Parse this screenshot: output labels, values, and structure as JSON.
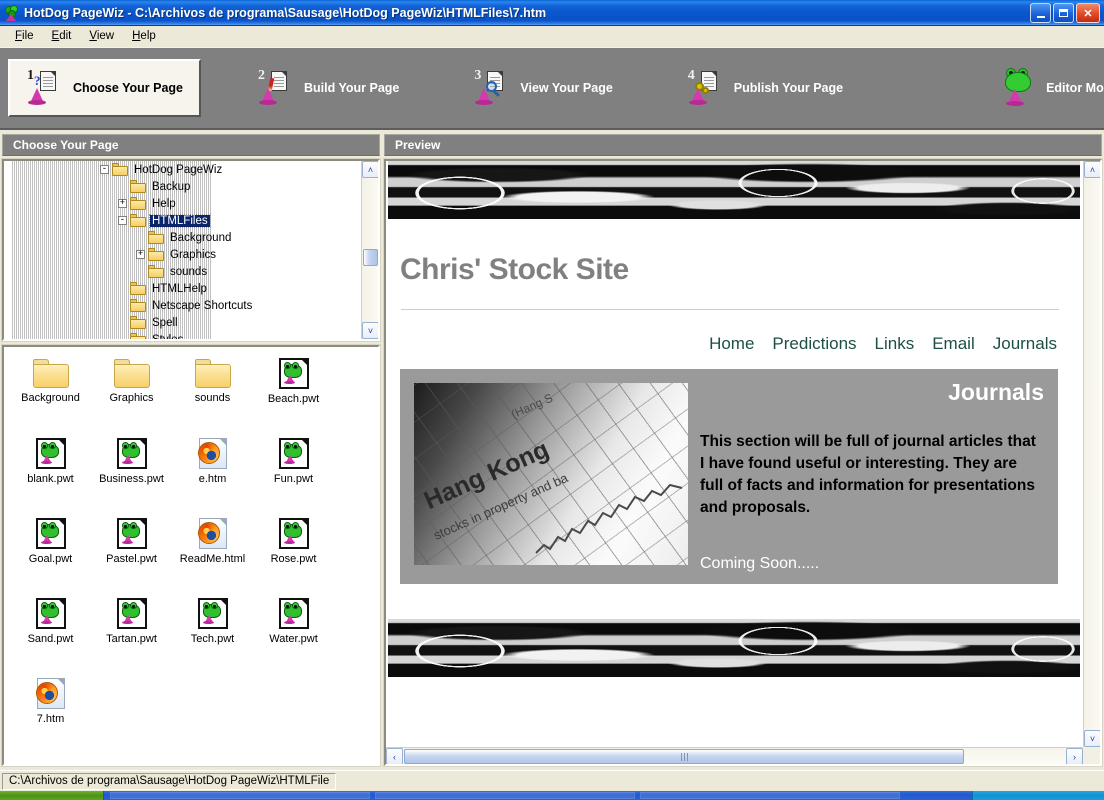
{
  "window": {
    "title": "HotDog PageWiz - C:\\Archivos de programa\\Sausage\\HotDog PageWiz\\HTMLFiles\\7.htm",
    "icon": "hotdog-pagewiz-frog-icon",
    "controls": {
      "minimize": "minimize-button",
      "maximize": "maximize-button",
      "close_label": "✕"
    }
  },
  "menubar": {
    "items": [
      {
        "label": "File",
        "accel": "F"
      },
      {
        "label": "Edit",
        "accel": "E"
      },
      {
        "label": "View",
        "accel": "V"
      },
      {
        "label": "Help",
        "accel": "H"
      }
    ]
  },
  "toolbar": {
    "steps": [
      {
        "number": "1",
        "label": "Choose Your Page",
        "icon": "page-question-wizard-icon",
        "active": true
      },
      {
        "number": "2",
        "label": "Build Your Page",
        "icon": "page-pen-wizard-icon",
        "active": false
      },
      {
        "number": "3",
        "label": "View Your Page",
        "icon": "page-magnifier-wizard-icon",
        "active": false
      },
      {
        "number": "4",
        "label": "Publish Your Page",
        "icon": "page-gears-wizard-icon",
        "active": false
      }
    ],
    "editor_mode": {
      "label": "Editor Mode",
      "icon": "frog-wizard-icon"
    }
  },
  "left_panel": {
    "header": "Choose Your Page",
    "tree": [
      {
        "label": "HotDog PageWiz",
        "depth": 0,
        "toggle": "-",
        "icon": "folder-icon",
        "selected": false
      },
      {
        "label": "Backup",
        "depth": 1,
        "toggle": "",
        "icon": "folder-icon",
        "selected": false
      },
      {
        "label": "Help",
        "depth": 1,
        "toggle": "+",
        "icon": "folder-icon",
        "selected": false
      },
      {
        "label": "HTMLFiles",
        "depth": 1,
        "toggle": "-",
        "icon": "folder-icon",
        "selected": true
      },
      {
        "label": "Background",
        "depth": 2,
        "toggle": "",
        "icon": "folder-icon",
        "selected": false
      },
      {
        "label": "Graphics",
        "depth": 2,
        "toggle": "+",
        "icon": "folder-icon",
        "selected": false
      },
      {
        "label": "sounds",
        "depth": 2,
        "toggle": "",
        "icon": "folder-icon",
        "selected": false
      },
      {
        "label": "HTMLHelp",
        "depth": 1,
        "toggle": "",
        "icon": "folder-icon",
        "selected": false
      },
      {
        "label": "Netscape Shortcuts",
        "depth": 1,
        "toggle": "",
        "icon": "folder-icon",
        "selected": false
      },
      {
        "label": "Spell",
        "depth": 1,
        "toggle": "",
        "icon": "folder-icon",
        "selected": false
      },
      {
        "label": "Styles",
        "depth": 1,
        "toggle": "",
        "icon": "folder-icon",
        "selected": false
      }
    ],
    "files": [
      {
        "name": "Background",
        "type": "folder"
      },
      {
        "name": "Graphics",
        "type": "folder"
      },
      {
        "name": "sounds",
        "type": "folder"
      },
      {
        "name": "Beach.pwt",
        "type": "pwt"
      },
      {
        "name": "blank.pwt",
        "type": "pwt"
      },
      {
        "name": "Business.pwt",
        "type": "pwt"
      },
      {
        "name": "e.htm",
        "type": "htm"
      },
      {
        "name": "Fun.pwt",
        "type": "pwt"
      },
      {
        "name": "Goal.pwt",
        "type": "pwt"
      },
      {
        "name": "Pastel.pwt",
        "type": "pwt"
      },
      {
        "name": "ReadMe.html",
        "type": "htm"
      },
      {
        "name": "Rose.pwt",
        "type": "pwt"
      },
      {
        "name": "Sand.pwt",
        "type": "pwt"
      },
      {
        "name": "Tartan.pwt",
        "type": "pwt"
      },
      {
        "name": "Tech.pwt",
        "type": "pwt"
      },
      {
        "name": "Water.pwt",
        "type": "pwt"
      },
      {
        "name": "7.htm",
        "type": "htm"
      }
    ]
  },
  "preview": {
    "header": "Preview",
    "page": {
      "banner_alt": "grayscale-liquid-banner-image",
      "site_title": "Chris' Stock Site",
      "nav": [
        "Home",
        "Predictions",
        "Links",
        "Email",
        "Journals"
      ],
      "section": {
        "heading": "Journals",
        "photo_alt": "hong-kong-stocks-newspaper-photo",
        "photo_text_main": "Hang Kong",
        "photo_text_sub": "stocks in property and ba",
        "photo_text_top": "(Hang S",
        "body": "This section will be full of journal articles that I have found useful or interesting. They are full of facts and information for presentations and proposals.",
        "footer": "Coming Soon....."
      }
    },
    "scroll": {
      "left_arrow": "‹",
      "right_arrow": "›",
      "up_arrow": "˄",
      "down_arrow": "˅"
    }
  },
  "statusbar": {
    "path": "C:\\Archivos de programa\\Sausage\\HotDog PageWiz\\HTMLFile"
  },
  "colors": {
    "titlebar_blue": "#0a57cc",
    "panel_header_gray": "#808080",
    "toolbar_gray": "#808080",
    "window_face": "#ece9d8",
    "selection_blue": "#0a246a",
    "nav_link_teal": "#1d4f45",
    "site_title_gray": "#808080",
    "content_gray": "#9a9a9a"
  }
}
